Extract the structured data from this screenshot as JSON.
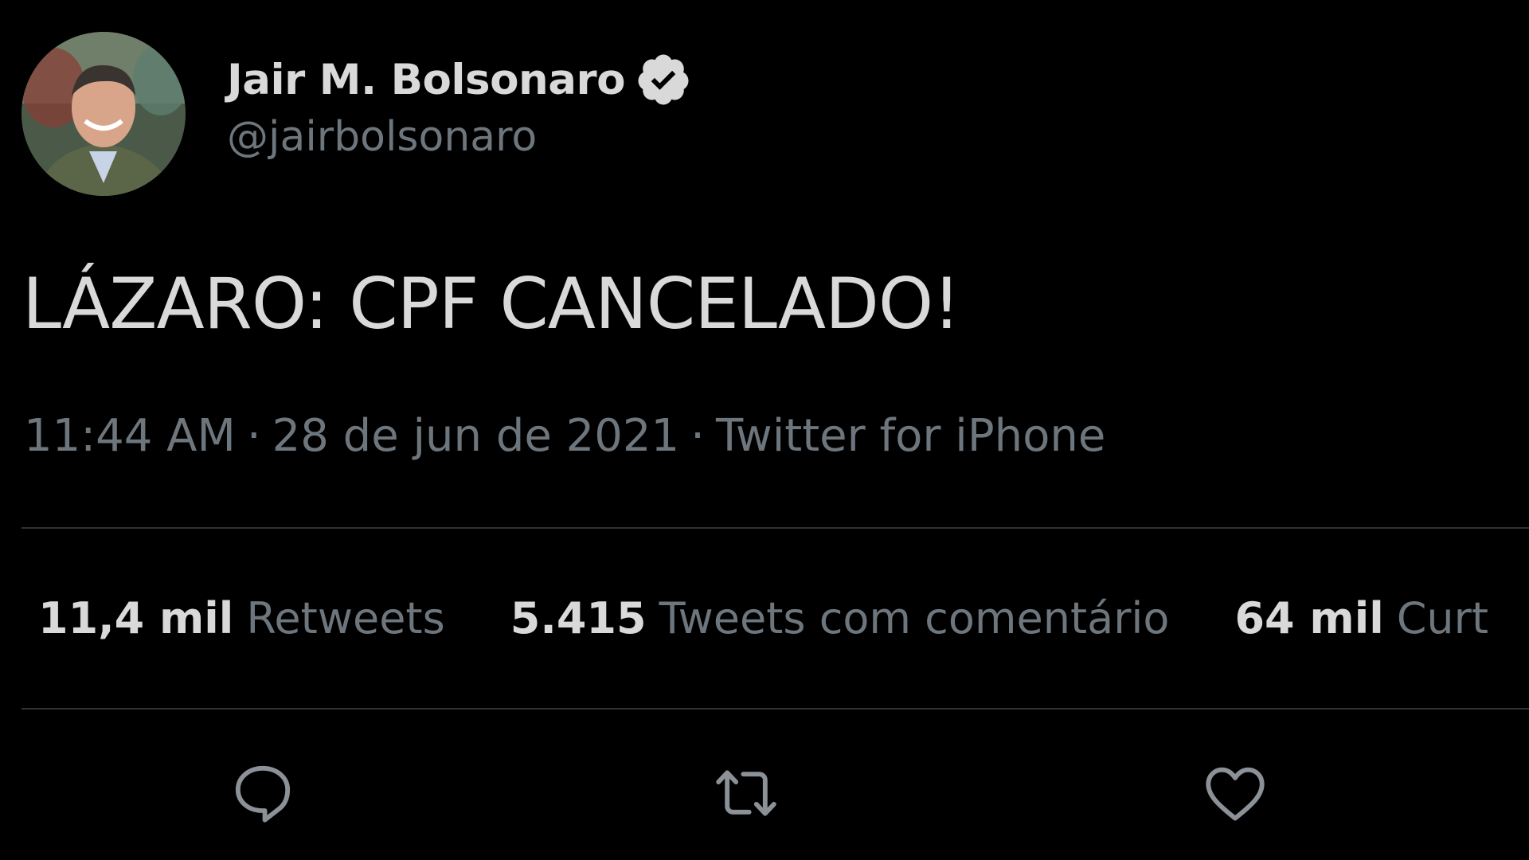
{
  "author": {
    "display_name": "Jair M. Bolsonaro",
    "handle": "@jairbolsonaro",
    "verified_icon": "verified-badge-icon"
  },
  "tweet": {
    "text": "LÁZARO: CPF CANCELADO!",
    "time": "11:44 AM",
    "separator": "·",
    "date": "28 de jun de 2021",
    "source": "Twitter for iPhone"
  },
  "stats": {
    "retweets": {
      "count": "11,4 mil",
      "label": "Retweets"
    },
    "quote_tweets": {
      "count": "5.415",
      "label": "Tweets com comentário"
    },
    "likes": {
      "count": "64 mil",
      "label": "Curt"
    }
  },
  "actions": {
    "reply_icon": "reply-icon",
    "retweet_icon": "retweet-icon",
    "like_icon": "heart-icon"
  },
  "colors": {
    "background": "#000000",
    "primary_text": "#d9d9d9",
    "secondary_text": "#6e767d",
    "divider": "#2f3336"
  }
}
